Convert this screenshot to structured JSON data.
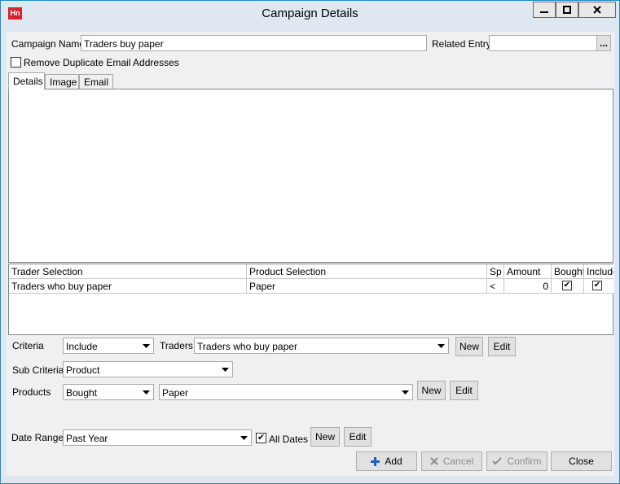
{
  "window": {
    "title": "Campaign Details",
    "app_icon_text": "Hn"
  },
  "header": {
    "campaign_name_label": "Campaign Name",
    "campaign_name_value": "Traders buy paper",
    "related_entry_label": "Related Entry",
    "related_entry_value": "",
    "related_entry_button": "...",
    "remove_duplicates_label": "Remove Duplicate Email Addresses",
    "remove_duplicates_checked": false
  },
  "tabs": [
    {
      "label": "Details",
      "active": true
    },
    {
      "label": "Image",
      "active": false
    },
    {
      "label": "Email",
      "active": false
    }
  ],
  "grid": {
    "columns": [
      "Trader Selection",
      "Product Selection",
      "Sp",
      "Amount",
      "Bought",
      "Include"
    ],
    "rows": [
      {
        "trader": "Traders who buy paper",
        "product": "Paper",
        "sp": "<",
        "amount": "0",
        "bought": true,
        "include": true
      }
    ]
  },
  "criteria": {
    "criteria_label": "Criteria",
    "criteria_value": "Include",
    "traders_label": "Traders",
    "traders_value": "Traders who buy paper",
    "sub_criteria_label": "Sub Criteria",
    "sub_criteria_value": "Product",
    "products_label": "Products",
    "products_mode_value": "Bought",
    "products_value": "Paper",
    "date_range_label": "Date Range",
    "date_range_value": "Past Year",
    "all_dates_label": "All Dates",
    "all_dates_checked": true,
    "new_label": "New",
    "edit_label": "Edit"
  },
  "footer": {
    "add_label": "Add",
    "cancel_label": "Cancel",
    "confirm_label": "Confirm",
    "close_label": "Close"
  },
  "colors": {
    "accent": "#1e8ac8",
    "app_icon": "#d7232f",
    "add_icon": "#1f5fbf"
  }
}
